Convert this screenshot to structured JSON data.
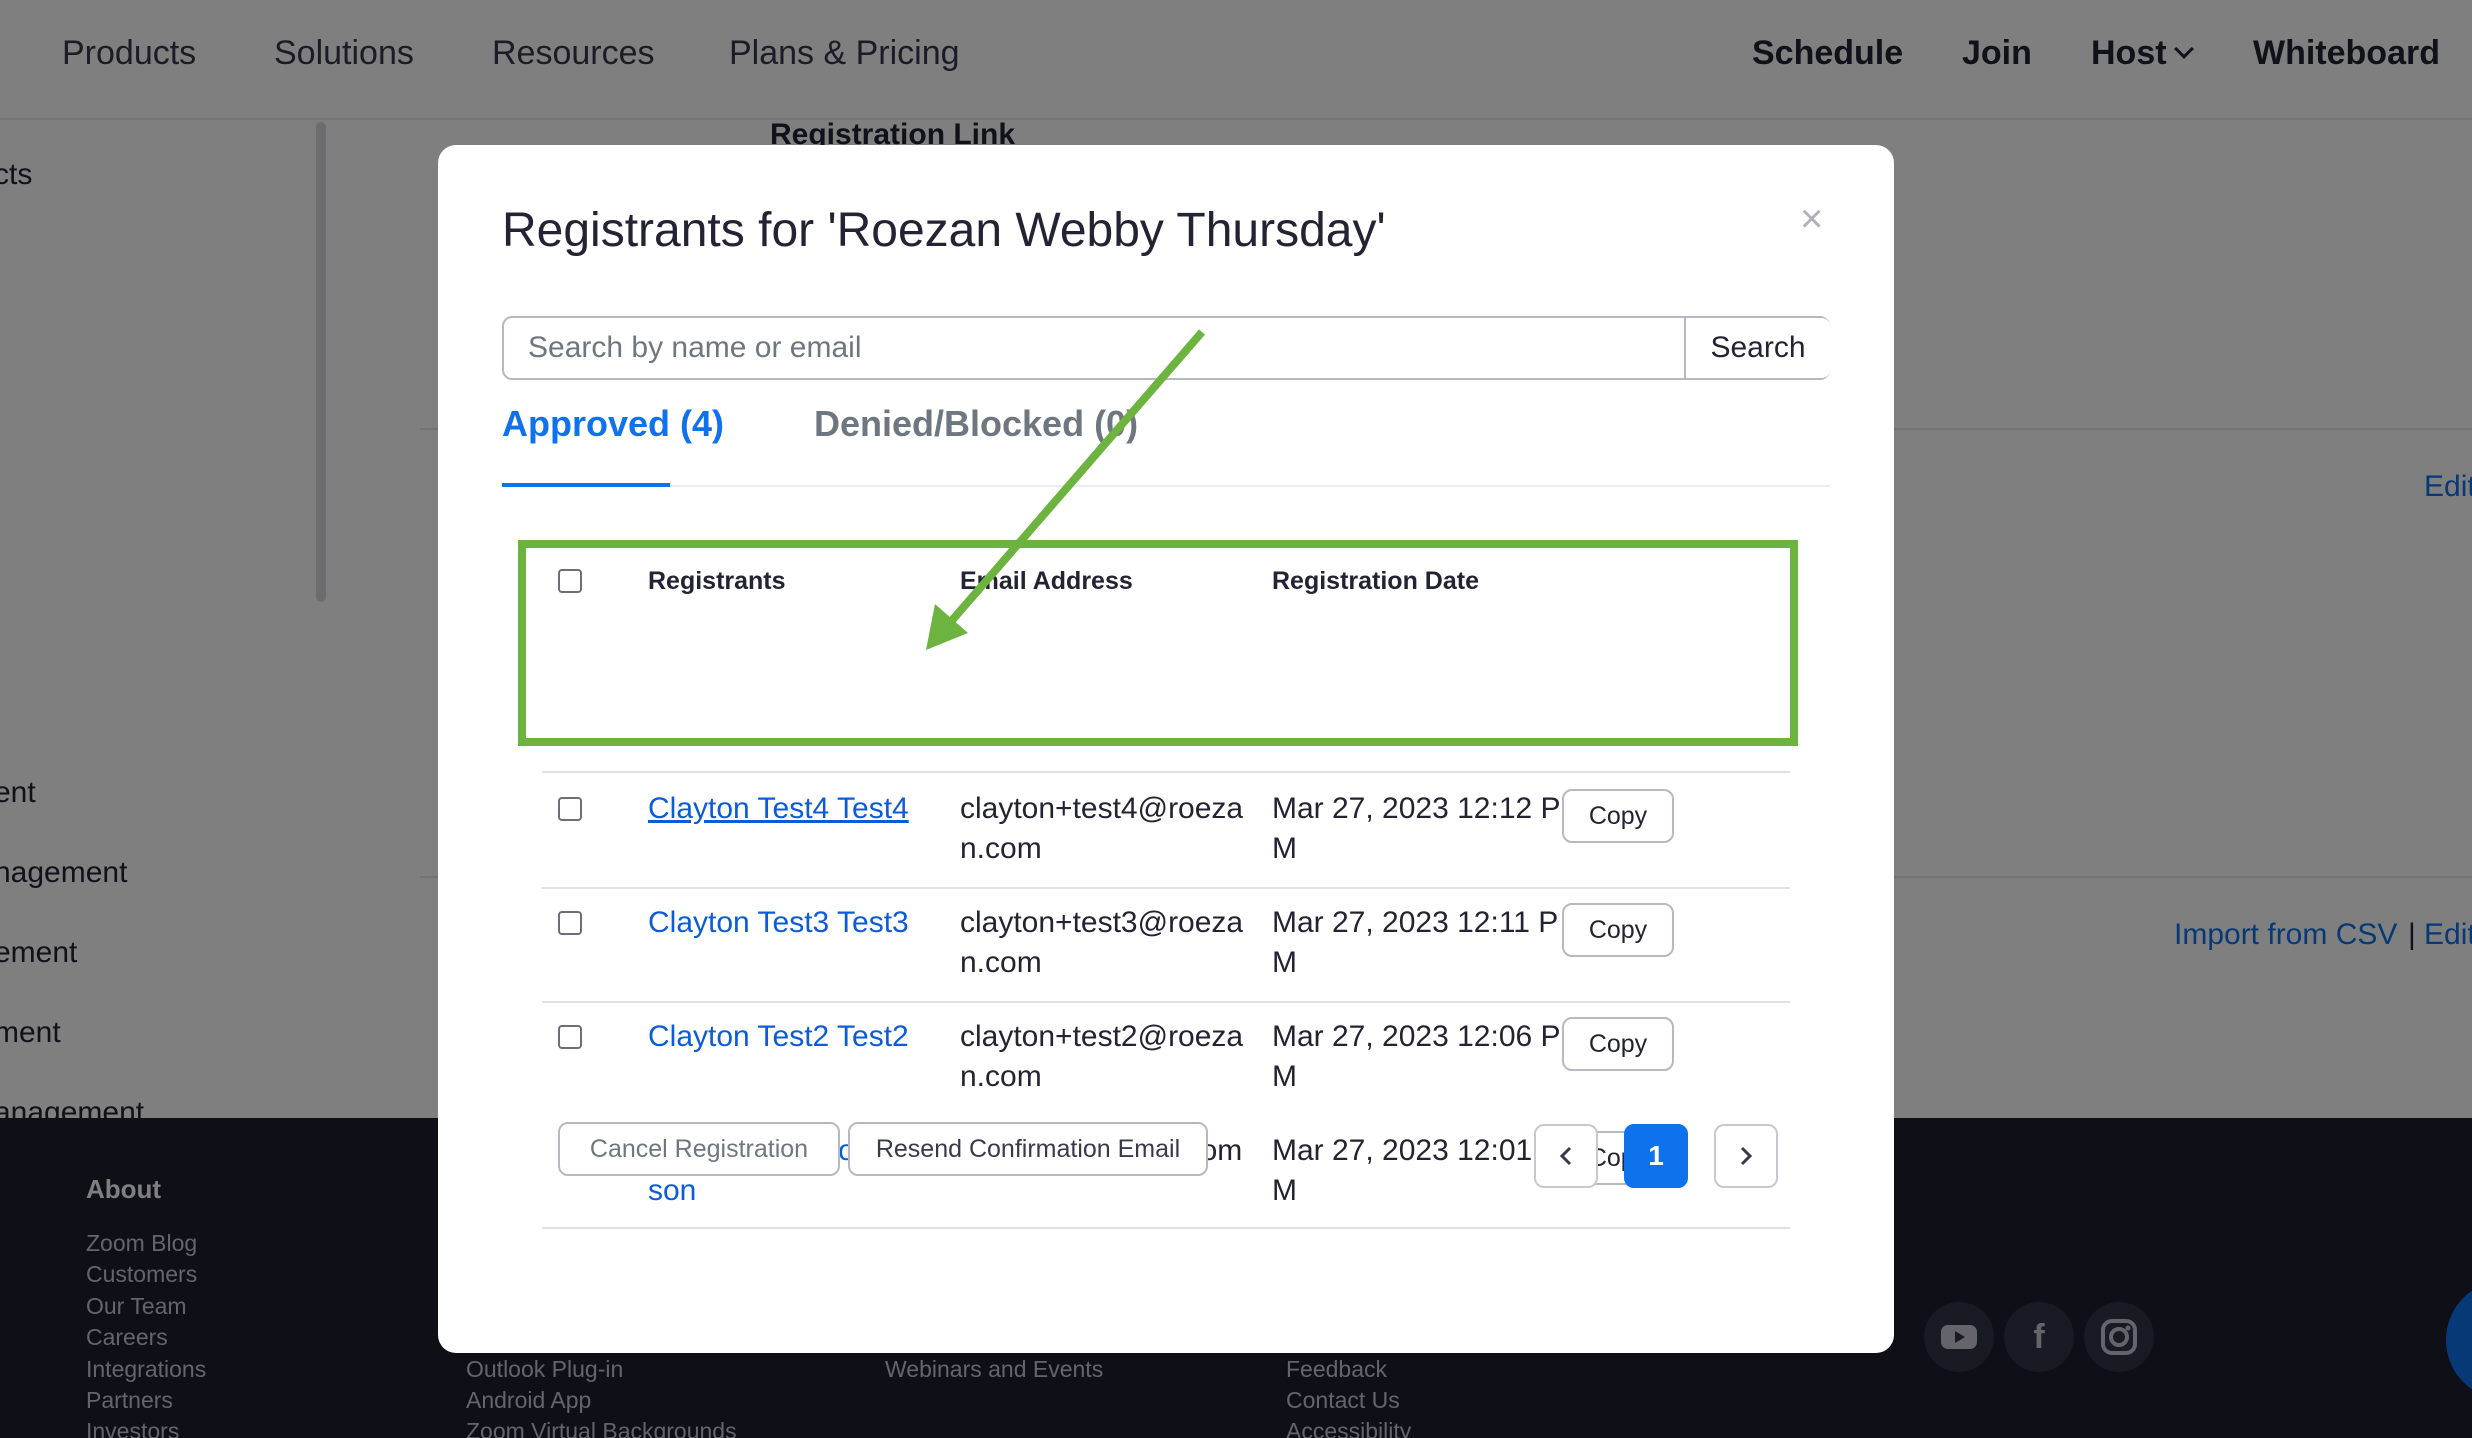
{
  "topnav": {
    "left": [
      "Products",
      "Solutions",
      "Resources",
      "Plans & Pricing"
    ],
    "right": [
      "Schedule",
      "Join",
      "Host",
      "Whiteboard"
    ]
  },
  "background": {
    "registration_link_label": "Registration Link",
    "sidebar_items": [
      "cts",
      "ent",
      "nagement",
      "ement",
      "ment",
      "anagement"
    ],
    "edit_link": "Edit",
    "import_csv_link": "Import from CSV",
    "separator": "|",
    "edit_link_2": "Edit"
  },
  "footer": {
    "about_heading": "About",
    "about_links": [
      "Zoom Blog",
      "Customers",
      "Our Team",
      "Careers",
      "Integrations",
      "Partners",
      "Investors"
    ],
    "col2_links": [
      "Outlook Plug-in",
      "Android App",
      "Zoom Virtual Backgrounds"
    ],
    "col3_links": [
      "Webinars and Events"
    ],
    "col4_links": [
      "Feedback",
      "Contact Us",
      "Accessibility"
    ],
    "social_icons": [
      "youtube-icon",
      "facebook-icon",
      "instagram-icon"
    ]
  },
  "modal": {
    "title": "Registrants for 'Roezan Webby Thursday'",
    "close": "×",
    "search": {
      "placeholder": "Search by name or email",
      "button": "Search"
    },
    "tabs": [
      {
        "label": "Approved (4)",
        "active": true
      },
      {
        "label": "Denied/Blocked (0)",
        "active": false
      }
    ],
    "table": {
      "headers": [
        "Registrants",
        "Email Address",
        "Registration Date"
      ],
      "rows": [
        {
          "name": "Clayton Test4 Test4",
          "email": "clayton+test4@roezan.com",
          "date": "Mar 27, 2023 12:12 PM",
          "copy": "Copy"
        },
        {
          "name": "Clayton Test3 Test3",
          "email": "clayton+test3@roezan.com",
          "date": "Mar 27, 2023 12:11 PM",
          "copy": "Copy"
        },
        {
          "name": "Clayton Test2 Test2",
          "email": "clayton+test2@roezan.com",
          "date": "Mar 27, 2023 12:06 PM",
          "copy": "Copy"
        },
        {
          "name": "Clayton Johnson Johnson",
          "email": "clayton@roezan.com",
          "date": "Mar 27, 2023 12:01 PM",
          "copy": "Copy"
        }
      ]
    },
    "actions": {
      "cancel": "Cancel Registration",
      "resend": "Resend Confirmation Email"
    },
    "pagination": {
      "current": "1"
    }
  },
  "annotation": {
    "highlight_color": "#6cb33f",
    "arrow_color": "#6cb33f"
  },
  "colors": {
    "accent": "#0e72ed",
    "link": "#0b5cd6"
  }
}
